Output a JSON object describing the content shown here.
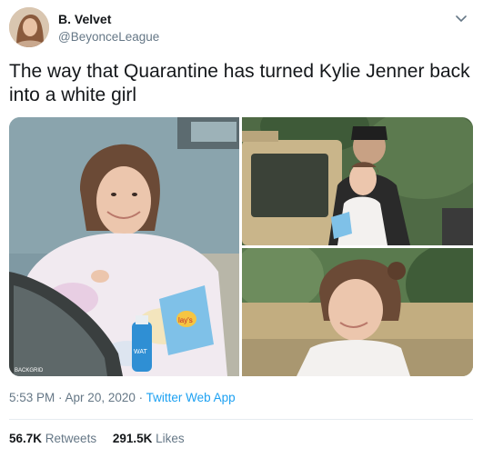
{
  "author": {
    "name": "B. Velvet",
    "handle": "@BeyonceLeague"
  },
  "tweet": {
    "text": "The way that Quarantine has turned Kylie Jenner back into a white girl"
  },
  "media": {
    "photo_credit": "BACKGRID",
    "snack_bag_label": "lay's",
    "bottle_label": "WAT"
  },
  "meta": {
    "time": "5:53 PM",
    "sep1": " · ",
    "date": "Apr 20, 2020",
    "sep2": " · ",
    "source": "Twitter Web App"
  },
  "stats": {
    "retweets_count": "56.7K",
    "retweets_label": "Retweets",
    "likes_count": "291.5K",
    "likes_label": "Likes"
  },
  "icons": {
    "caret": "chevron-down-icon"
  },
  "colors": {
    "link": "#1da1f2",
    "secondary_text": "#657786",
    "primary_text": "#14171a",
    "divider": "#e6ecf0"
  }
}
